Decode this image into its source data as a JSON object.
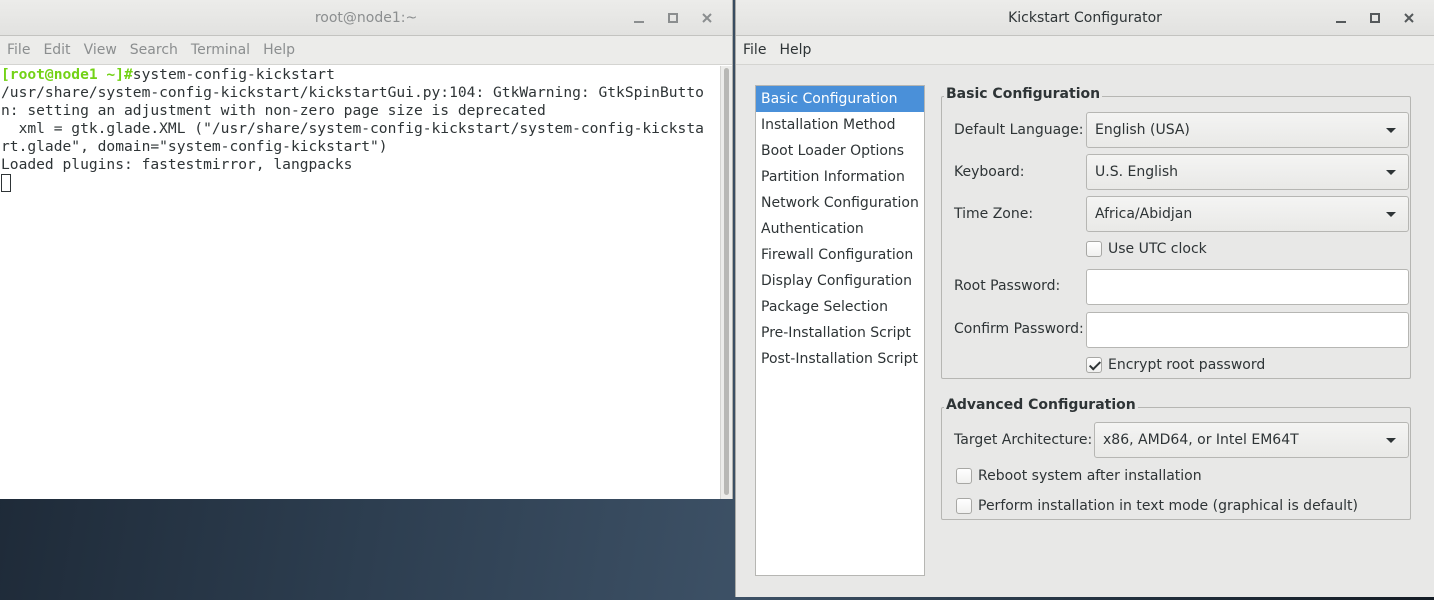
{
  "terminal": {
    "title": "root@node1:~",
    "menu": [
      "File",
      "Edit",
      "View",
      "Search",
      "Terminal",
      "Help"
    ],
    "prompt": "[root@node1 ~]#",
    "command": "system-config-kickstart",
    "output_lines": [
      "/usr/share/system-config-kickstart/kickstartGui.py:104: GtkWarning: GtkSpinButto",
      "n: setting an adjustment with non-zero page size is deprecated",
      "  xml = gtk.glade.XML (\"/usr/share/system-config-kickstart/system-config-kicksta",
      "rt.glade\", domain=\"system-config-kickstart\")",
      "Loaded plugins: fastestmirror, langpacks"
    ]
  },
  "kickstart": {
    "title": "Kickstart Configurator",
    "menu": [
      "File",
      "Help"
    ],
    "nav_items": [
      "Basic Configuration",
      "Installation Method",
      "Boot Loader Options",
      "Partition Information",
      "Network Configuration",
      "Authentication",
      "Firewall Configuration",
      "Display Configuration",
      "Package Selection",
      "Pre-Installation Script",
      "Post-Installation Script"
    ],
    "selected_nav": "Basic Configuration",
    "basic": {
      "title": "Basic Configuration",
      "default_language_label": "Default Language:",
      "default_language_value": "English (USA)",
      "keyboard_label": "Keyboard:",
      "keyboard_value": "U.S. English",
      "time_zone_label": "Time Zone:",
      "time_zone_value": "Africa/Abidjan",
      "utc_clock_label": "Use UTC clock",
      "utc_clock_checked": false,
      "root_password_label": "Root Password:",
      "root_password_value": "",
      "confirm_password_label": "Confirm Password:",
      "confirm_password_value": "",
      "encrypt_label": "Encrypt root password",
      "encrypt_checked": true
    },
    "advanced": {
      "title": "Advanced Configuration",
      "target_arch_label": "Target Architecture:",
      "target_arch_value": "x86, AMD64, or Intel EM64T",
      "reboot_label": "Reboot system after installation",
      "reboot_checked": false,
      "text_mode_label": "Perform installation in text mode (graphical is default)",
      "text_mode_checked": false
    }
  }
}
